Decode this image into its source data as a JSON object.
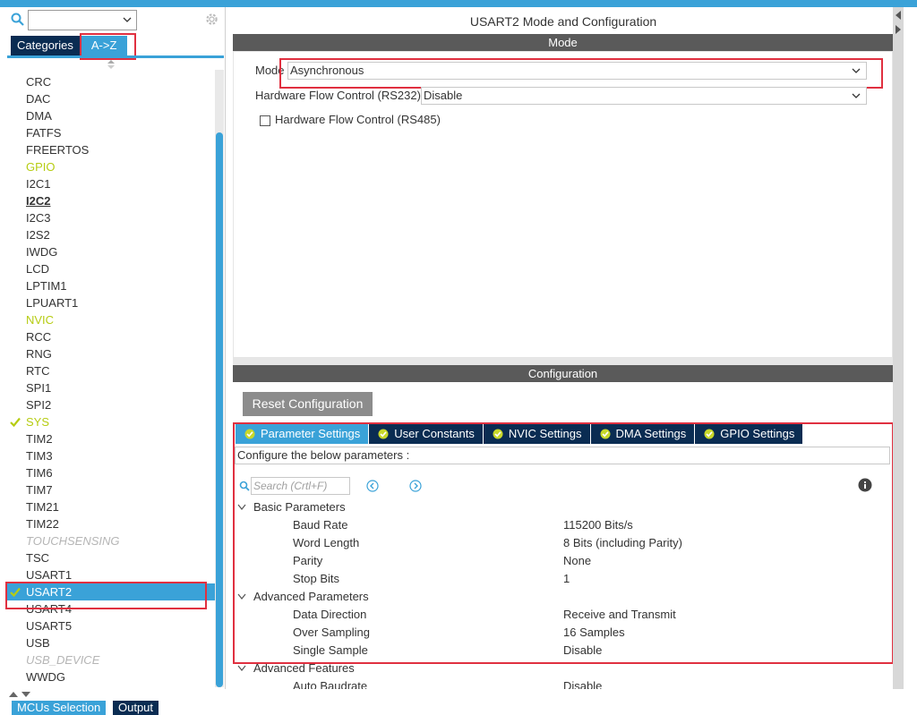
{
  "left_panel": {
    "search_value": "",
    "tabs": {
      "categories": "Categories",
      "az": "A->Z"
    },
    "items": [
      {
        "label": "CRC",
        "style": "normal"
      },
      {
        "label": "DAC",
        "style": "normal"
      },
      {
        "label": "DMA",
        "style": "normal"
      },
      {
        "label": "FATFS",
        "style": "normal"
      },
      {
        "label": "FREERTOS",
        "style": "normal"
      },
      {
        "label": "GPIO",
        "style": "yellow"
      },
      {
        "label": "I2C1",
        "style": "normal"
      },
      {
        "label": "I2C2",
        "style": "underlined"
      },
      {
        "label": "I2C3",
        "style": "normal"
      },
      {
        "label": "I2S2",
        "style": "normal"
      },
      {
        "label": "IWDG",
        "style": "normal"
      },
      {
        "label": "LCD",
        "style": "normal"
      },
      {
        "label": "LPTIM1",
        "style": "normal"
      },
      {
        "label": "LPUART1",
        "style": "normal"
      },
      {
        "label": "NVIC",
        "style": "yellow"
      },
      {
        "label": "RCC",
        "style": "normal"
      },
      {
        "label": "RNG",
        "style": "normal"
      },
      {
        "label": "RTC",
        "style": "normal"
      },
      {
        "label": "SPI1",
        "style": "normal"
      },
      {
        "label": "SPI2",
        "style": "normal"
      },
      {
        "label": "SYS",
        "style": "yellow-checked"
      },
      {
        "label": "TIM2",
        "style": "normal"
      },
      {
        "label": "TIM3",
        "style": "normal"
      },
      {
        "label": "TIM6",
        "style": "normal"
      },
      {
        "label": "TIM7",
        "style": "normal"
      },
      {
        "label": "TIM21",
        "style": "normal"
      },
      {
        "label": "TIM22",
        "style": "normal"
      },
      {
        "label": "TOUCHSENSING",
        "style": "disabled"
      },
      {
        "label": "TSC",
        "style": "normal"
      },
      {
        "label": "USART1",
        "style": "normal"
      },
      {
        "label": "USART2",
        "style": "selected-checked"
      },
      {
        "label": "USART4",
        "style": "normal"
      },
      {
        "label": "USART5",
        "style": "normal"
      },
      {
        "label": "USB",
        "style": "normal"
      },
      {
        "label": "USB_DEVICE",
        "style": "disabled"
      },
      {
        "label": "WWDG",
        "style": "normal"
      }
    ]
  },
  "bottom_tabs": {
    "mcus": "MCUs Selection",
    "output": "Output"
  },
  "right_panel": {
    "title": "USART2 Mode and Configuration",
    "mode_section": "Mode",
    "mode_label": "Mode",
    "mode_value": "Asynchronous",
    "hfc232_label": "Hardware Flow Control (RS232)",
    "hfc232_value": "Disable",
    "hfc485_label": "Hardware Flow Control (RS485)",
    "config_section": "Configuration",
    "reset_button": "Reset Configuration",
    "tabs": [
      "Parameter Settings",
      "User Constants",
      "NVIC Settings",
      "DMA Settings",
      "GPIO Settings"
    ],
    "configure_note": "Configure the below parameters :",
    "search_placeholder": "Search (Crtl+F)",
    "groups": {
      "basic": "Basic Parameters",
      "advanced": "Advanced Parameters",
      "features": "Advanced Features"
    },
    "params": [
      {
        "name": "Baud Rate",
        "value": "115200 Bits/s"
      },
      {
        "name": "Word Length",
        "value": "8 Bits (including Parity)"
      },
      {
        "name": "Parity",
        "value": "None"
      },
      {
        "name": "Stop Bits",
        "value": "1"
      },
      {
        "name": "Data Direction",
        "value": "Receive and Transmit"
      },
      {
        "name": "Over Sampling",
        "value": "16 Samples"
      },
      {
        "name": "Single Sample",
        "value": "Disable"
      },
      {
        "name": "Auto Baudrate",
        "value": "Disable"
      }
    ]
  },
  "colors": {
    "accent": "#3aa2d8",
    "navy": "#0a2c52",
    "highlight": "#e03040",
    "yellow": "#b6cc12"
  }
}
